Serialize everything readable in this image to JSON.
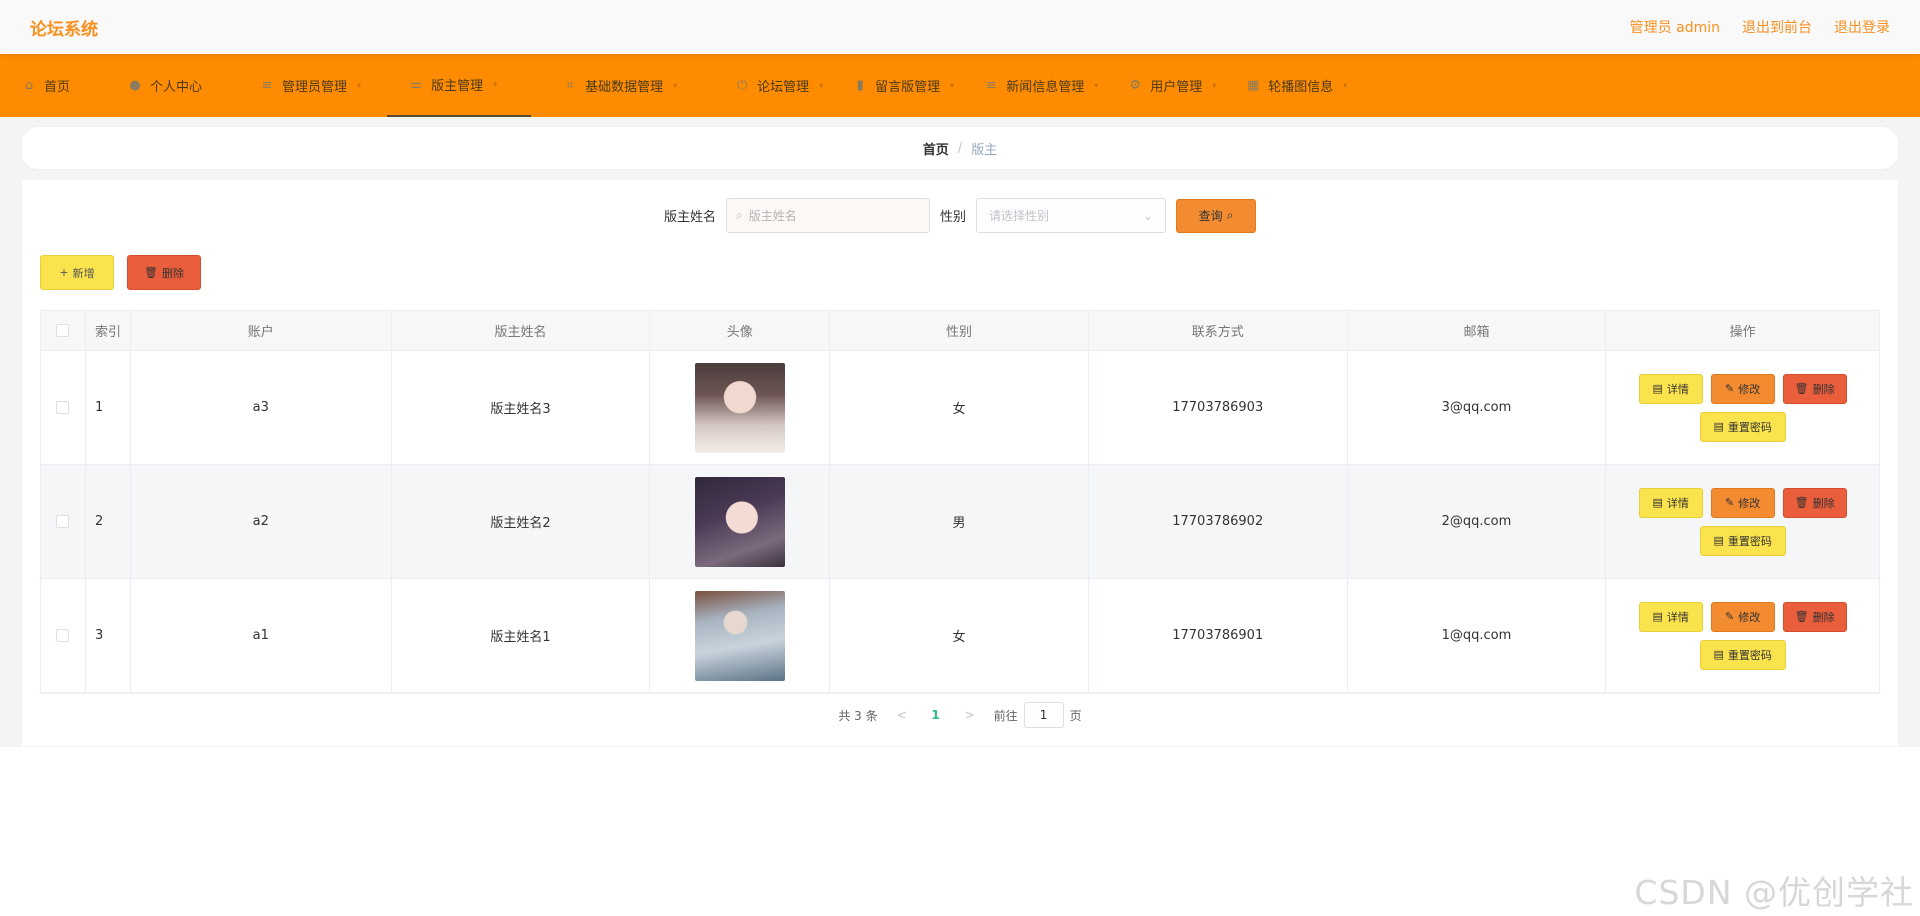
{
  "header": {
    "brand": "论坛系统",
    "admin_label": "管理员 admin",
    "front_label": "退出到前台",
    "logout_label": "退出登录"
  },
  "nav": [
    {
      "label": "首页",
      "icon": "home-icon",
      "caret": false
    },
    {
      "label": "个人中心",
      "icon": "user-icon",
      "caret": false
    },
    {
      "label": "管理员管理",
      "icon": "list-icon",
      "caret": true
    },
    {
      "label": "版主管理",
      "icon": "moderator-icon",
      "caret": true
    },
    {
      "label": "基础数据管理",
      "icon": "crop-icon",
      "caret": true
    },
    {
      "label": "论坛管理",
      "icon": "power-icon",
      "caret": true
    },
    {
      "label": "留言版管理",
      "icon": "bar-chart-icon",
      "caret": true
    },
    {
      "label": "新闻信息管理",
      "icon": "list-icon",
      "caret": true
    },
    {
      "label": "用户管理",
      "icon": "settings-icon",
      "caret": true
    },
    {
      "label": "轮播图信息",
      "icon": "grid-icon",
      "caret": true
    }
  ],
  "breadcrumb": {
    "home": "首页",
    "sep": "/",
    "current": "版主"
  },
  "search": {
    "name_label": "版主姓名",
    "name_placeholder": "版主姓名",
    "sex_label": "性别",
    "sex_placeholder": "请选择性别",
    "query_label": "查询"
  },
  "actions": {
    "add_label": "新增",
    "delete_label": "删除"
  },
  "table": {
    "headers": [
      "索引",
      "账户",
      "版主姓名",
      "头像",
      "性别",
      "联系方式",
      "邮箱",
      "操作"
    ],
    "rows": [
      {
        "index": "1",
        "account": "a3",
        "name": "版主姓名3",
        "sex": "女",
        "phone": "17703786903",
        "email": "3@qq.com"
      },
      {
        "index": "2",
        "account": "a2",
        "name": "版主姓名2",
        "sex": "男",
        "phone": "17703786902",
        "email": "2@qq.com"
      },
      {
        "index": "3",
        "account": "a1",
        "name": "版主姓名1",
        "sex": "女",
        "phone": "17703786901",
        "email": "1@qq.com"
      }
    ],
    "ops": {
      "detail": "详情",
      "edit": "修改",
      "delete": "删除",
      "reset": "重置密码"
    }
  },
  "pagination": {
    "total": "共 3 条",
    "current": "1",
    "goto_label": "前往",
    "goto_value": "1",
    "page_suffix": "页"
  },
  "watermark": "CSDN @优创学社",
  "colors": {
    "brand": "#f7901e",
    "nav_bg": "#ff8c00",
    "yellow": "#fbe34d",
    "orange": "#f38b31",
    "red": "#ea5e3c"
  }
}
